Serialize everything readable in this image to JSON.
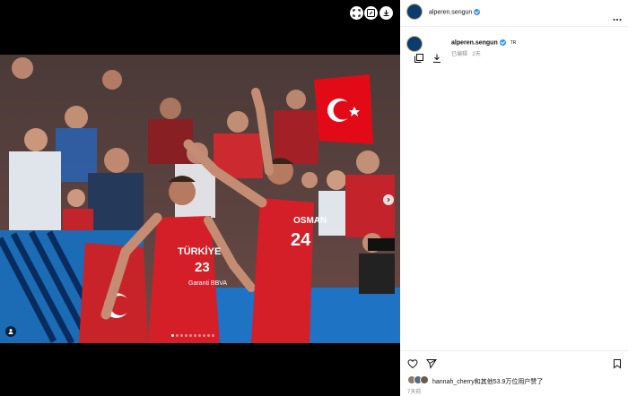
{
  "post": {
    "username": "alperen.sengun",
    "tag": "TR",
    "edited_label": "已编辑 · 2天",
    "likes_text": "hannah_cherry和其他53.9万位用户赞了",
    "time_ago": "7天前"
  },
  "photo": {
    "jersey_left_team": "TÜRKİYE",
    "jersey_left_number": "23",
    "jersey_left_sponsor": "Garanti BBVA",
    "jersey_right_name": "OSMAN",
    "jersey_right_number": "24",
    "carousel_count": 10,
    "carousel_active": 1
  },
  "colors": {
    "jersey_red": "#d41f28",
    "flag_red": "#e30a17",
    "verified_blue": "#3897f0"
  },
  "icons": {
    "top": [
      "expand-icon",
      "edit-icon",
      "download-icon"
    ],
    "actions": [
      "heart-icon",
      "share-icon",
      "bookmark-icon"
    ]
  }
}
